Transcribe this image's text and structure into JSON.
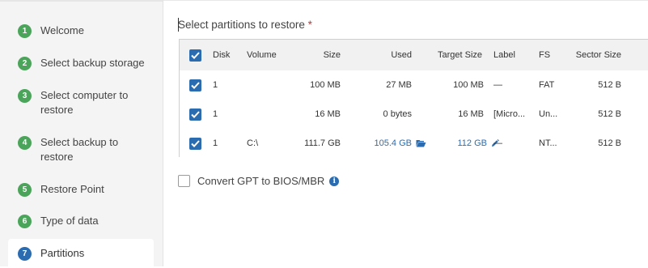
{
  "steps": [
    {
      "num": "1",
      "label": "Welcome"
    },
    {
      "num": "2",
      "label": "Select backup storage"
    },
    {
      "num": "3",
      "label": "Select computer to restore"
    },
    {
      "num": "4",
      "label": "Select backup to restore"
    },
    {
      "num": "5",
      "label": "Restore Point"
    },
    {
      "num": "6",
      "label": "Type of data"
    },
    {
      "num": "7",
      "label": "Partitions"
    }
  ],
  "step3_lines": [
    "Select computer to",
    "restore"
  ],
  "step4_lines": [
    "Select backup to",
    "restore"
  ],
  "main": {
    "title": "Select partitions to restore",
    "required_mark": "*"
  },
  "table": {
    "headers": {
      "disk": "Disk",
      "volume": "Volume",
      "size": "Size",
      "used": "Used",
      "target_size": "Target Size",
      "label": "Label",
      "fs": "FS",
      "sector_size": "Sector Size"
    },
    "rows": [
      {
        "disk": "1",
        "volume": "",
        "size": "100 MB",
        "used": "27 MB",
        "target_size": "100 MB",
        "label": "—",
        "fs": "FAT",
        "sector_size": "512 B"
      },
      {
        "disk": "1",
        "volume": "",
        "size": "16 MB",
        "used": "0 bytes",
        "target_size": "16 MB",
        "label": "[Micro...",
        "fs": "Un...",
        "sector_size": "512 B"
      },
      {
        "disk": "1",
        "volume": "C:\\",
        "size": "111.7 GB",
        "used": "105.4 GB",
        "target_size": "112 GB",
        "label": "—",
        "fs": "NT...",
        "sector_size": "512 B"
      }
    ]
  },
  "gpt_option": {
    "label": "Convert GPT to BIOS/MBR",
    "checked": false
  },
  "icons": {
    "check": "check-icon",
    "folder": "folder-open-icon",
    "edit": "pencil-icon",
    "info": "info-icon"
  },
  "colors": {
    "accent": "#2b6cb0",
    "step_done": "#4aa55a",
    "required": "#d32f2f"
  }
}
